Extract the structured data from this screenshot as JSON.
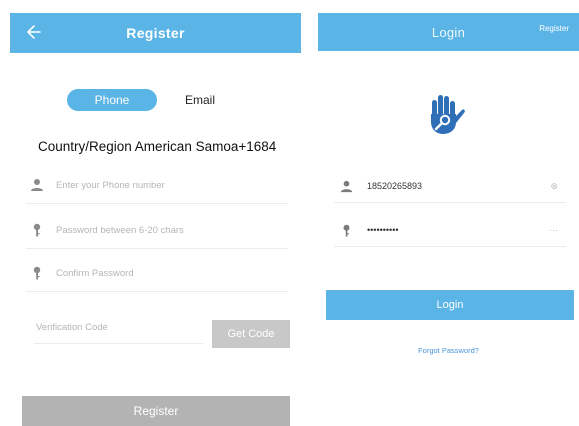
{
  "register": {
    "title": "Register",
    "tabs": {
      "phone": "Phone",
      "email": "Email"
    },
    "country": "Country/Region American Samoa+1684",
    "phone_placeholder": "Enter your Phone number",
    "password_placeholder": "Password between 6-20 chars",
    "confirm_placeholder": "Confirm Password",
    "verification_placeholder": "Verification Code",
    "get_code": "Get Code",
    "submit": "Register"
  },
  "login": {
    "title": "Login",
    "register_link": "Register",
    "username": "18520265893",
    "password": "••••••••••",
    "submit": "Login",
    "forgot": "Forgot Password?"
  },
  "colors": {
    "accent": "#5ab4e6",
    "disabled": "#b3b3b3",
    "hand_icon": "#2f6fb8"
  },
  "icons": [
    "back-arrow-icon",
    "user-icon",
    "key-icon",
    "hand-icon",
    "clear-icon",
    "more-icon"
  ]
}
